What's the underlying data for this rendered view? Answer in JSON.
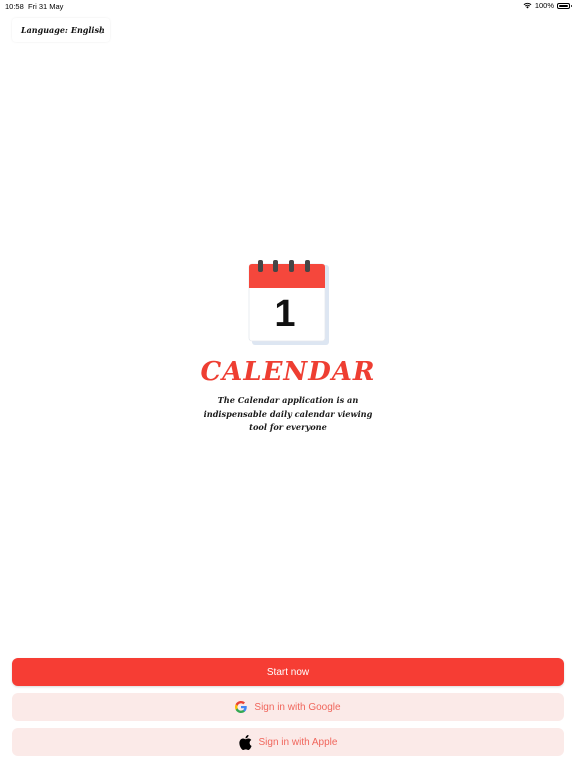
{
  "status_bar": {
    "time": "10:58",
    "date": "Fri 31 May",
    "battery": "100%"
  },
  "language": {
    "prefix": "Language:",
    "value": "English"
  },
  "logo": {
    "day_number": "1"
  },
  "app": {
    "title": "CALENDAR",
    "description_line1": "The Calendar application is an",
    "description_line2": "indispensable daily calendar viewing",
    "description_line3": "tool for everyone"
  },
  "buttons": {
    "start": "Start now",
    "google": "Sign in with Google",
    "apple": "Sign in with Apple"
  },
  "colors": {
    "accent": "#f63d34",
    "title": "#ee3e32",
    "secondary_bg": "#fbeae8",
    "secondary_text": "#f0665c"
  },
  "icons": {
    "wifi": "wifi-icon",
    "battery": "battery-icon",
    "chevron": "chevron-down-icon",
    "logo": "calendar-icon",
    "google": "google-icon",
    "apple": "apple-icon"
  }
}
